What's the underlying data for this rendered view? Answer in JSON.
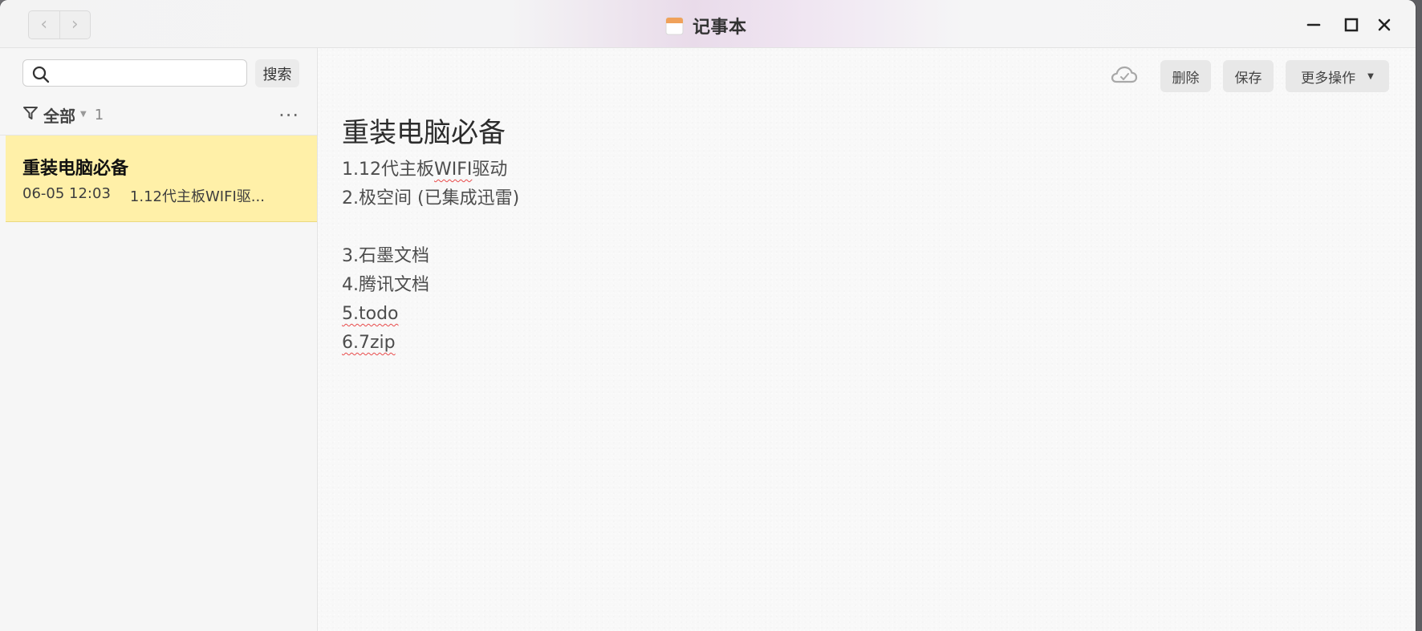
{
  "window": {
    "title": "记事本"
  },
  "sidebar": {
    "search": {
      "placeholder": "",
      "button_label": "搜索"
    },
    "filter": {
      "label": "全部",
      "count": "1",
      "more": "..."
    },
    "notes": [
      {
        "title": "重装电脑必备",
        "date": "06-05 12:03",
        "preview": "1.12代主板WIFI驱..."
      }
    ]
  },
  "toolbar": {
    "delete_label": "删除",
    "save_label": "保存",
    "more_label": "更多操作"
  },
  "editor": {
    "title": "重装电脑必备",
    "lines": [
      "1.12代主板",
      "WIFI",
      "驱动",
      "2.极空间 (已集成迅雷)",
      "3.石墨文档",
      "4.腾讯文档",
      "5.todo",
      "6.7zip"
    ]
  },
  "colors": {
    "selected_note": "#fff0a8",
    "spellcheck_underline": "#e84a4a"
  }
}
